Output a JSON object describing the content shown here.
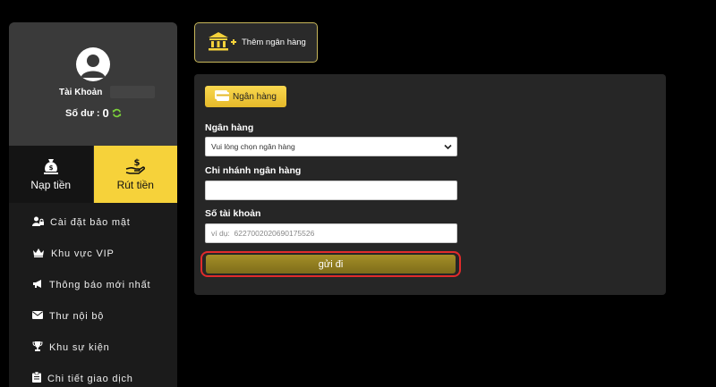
{
  "sidebar": {
    "account_label": "Tài Khoản",
    "balance_label": "Số dư :",
    "balance_value": "0",
    "tabs": [
      {
        "label": "Nạp tiền",
        "icon": "money-bag-icon"
      },
      {
        "label": "Rút tiền",
        "icon": "hand-money-icon"
      }
    ],
    "menu": [
      {
        "label": "Cài đặt bảo mật",
        "icon": "user-lock-icon"
      },
      {
        "label": "Khu vực VIP",
        "icon": "crown-icon"
      },
      {
        "label": "Thông báo mới nhất",
        "icon": "megaphone-icon"
      },
      {
        "label": "Thư nội bộ",
        "icon": "envelope-icon"
      },
      {
        "label": "Khu sự kiện",
        "icon": "trophy-icon"
      },
      {
        "label": "Chi tiết giao dịch",
        "icon": "clipboard-icon"
      }
    ]
  },
  "top": {
    "add_bank_label": "Thêm ngân hàng"
  },
  "form": {
    "tab_label": "Ngân hàng",
    "bank_label": "Ngân hàng",
    "bank_select_value": "Vui lòng chọn ngân hàng",
    "branch_label": "Chi nhánh ngân hàng",
    "branch_value": "",
    "account_label": "Số tài khoản",
    "account_placeholder": "ví dụ:  6227002020690175526",
    "submit_label": "gửi đi"
  },
  "colors": {
    "accent_yellow": "#f6d23a",
    "submit_gold": "#8f7c20",
    "highlight_red": "#e12b2b"
  }
}
